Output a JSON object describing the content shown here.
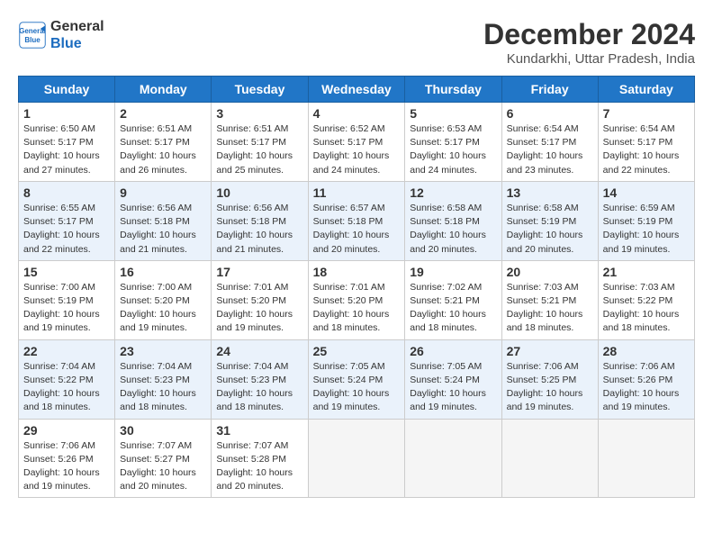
{
  "logo": {
    "line1": "General",
    "line2": "Blue"
  },
  "title": "December 2024",
  "location": "Kundarkhi, Uttar Pradesh, India",
  "weekdays": [
    "Sunday",
    "Monday",
    "Tuesday",
    "Wednesday",
    "Thursday",
    "Friday",
    "Saturday"
  ],
  "weeks": [
    [
      {
        "day": 1,
        "sunrise": "6:50 AM",
        "sunset": "5:17 PM",
        "daylight": "10 hours and 27 minutes."
      },
      {
        "day": 2,
        "sunrise": "6:51 AM",
        "sunset": "5:17 PM",
        "daylight": "10 hours and 26 minutes."
      },
      {
        "day": 3,
        "sunrise": "6:51 AM",
        "sunset": "5:17 PM",
        "daylight": "10 hours and 25 minutes."
      },
      {
        "day": 4,
        "sunrise": "6:52 AM",
        "sunset": "5:17 PM",
        "daylight": "10 hours and 24 minutes."
      },
      {
        "day": 5,
        "sunrise": "6:53 AM",
        "sunset": "5:17 PM",
        "daylight": "10 hours and 24 minutes."
      },
      {
        "day": 6,
        "sunrise": "6:54 AM",
        "sunset": "5:17 PM",
        "daylight": "10 hours and 23 minutes."
      },
      {
        "day": 7,
        "sunrise": "6:54 AM",
        "sunset": "5:17 PM",
        "daylight": "10 hours and 22 minutes."
      }
    ],
    [
      {
        "day": 8,
        "sunrise": "6:55 AM",
        "sunset": "5:17 PM",
        "daylight": "10 hours and 22 minutes."
      },
      {
        "day": 9,
        "sunrise": "6:56 AM",
        "sunset": "5:18 PM",
        "daylight": "10 hours and 21 minutes."
      },
      {
        "day": 10,
        "sunrise": "6:56 AM",
        "sunset": "5:18 PM",
        "daylight": "10 hours and 21 minutes."
      },
      {
        "day": 11,
        "sunrise": "6:57 AM",
        "sunset": "5:18 PM",
        "daylight": "10 hours and 20 minutes."
      },
      {
        "day": 12,
        "sunrise": "6:58 AM",
        "sunset": "5:18 PM",
        "daylight": "10 hours and 20 minutes."
      },
      {
        "day": 13,
        "sunrise": "6:58 AM",
        "sunset": "5:19 PM",
        "daylight": "10 hours and 20 minutes."
      },
      {
        "day": 14,
        "sunrise": "6:59 AM",
        "sunset": "5:19 PM",
        "daylight": "10 hours and 19 minutes."
      }
    ],
    [
      {
        "day": 15,
        "sunrise": "7:00 AM",
        "sunset": "5:19 PM",
        "daylight": "10 hours and 19 minutes."
      },
      {
        "day": 16,
        "sunrise": "7:00 AM",
        "sunset": "5:20 PM",
        "daylight": "10 hours and 19 minutes."
      },
      {
        "day": 17,
        "sunrise": "7:01 AM",
        "sunset": "5:20 PM",
        "daylight": "10 hours and 19 minutes."
      },
      {
        "day": 18,
        "sunrise": "7:01 AM",
        "sunset": "5:20 PM",
        "daylight": "10 hours and 18 minutes."
      },
      {
        "day": 19,
        "sunrise": "7:02 AM",
        "sunset": "5:21 PM",
        "daylight": "10 hours and 18 minutes."
      },
      {
        "day": 20,
        "sunrise": "7:03 AM",
        "sunset": "5:21 PM",
        "daylight": "10 hours and 18 minutes."
      },
      {
        "day": 21,
        "sunrise": "7:03 AM",
        "sunset": "5:22 PM",
        "daylight": "10 hours and 18 minutes."
      }
    ],
    [
      {
        "day": 22,
        "sunrise": "7:04 AM",
        "sunset": "5:22 PM",
        "daylight": "10 hours and 18 minutes."
      },
      {
        "day": 23,
        "sunrise": "7:04 AM",
        "sunset": "5:23 PM",
        "daylight": "10 hours and 18 minutes."
      },
      {
        "day": 24,
        "sunrise": "7:04 AM",
        "sunset": "5:23 PM",
        "daylight": "10 hours and 18 minutes."
      },
      {
        "day": 25,
        "sunrise": "7:05 AM",
        "sunset": "5:24 PM",
        "daylight": "10 hours and 19 minutes."
      },
      {
        "day": 26,
        "sunrise": "7:05 AM",
        "sunset": "5:24 PM",
        "daylight": "10 hours and 19 minutes."
      },
      {
        "day": 27,
        "sunrise": "7:06 AM",
        "sunset": "5:25 PM",
        "daylight": "10 hours and 19 minutes."
      },
      {
        "day": 28,
        "sunrise": "7:06 AM",
        "sunset": "5:26 PM",
        "daylight": "10 hours and 19 minutes."
      }
    ],
    [
      {
        "day": 29,
        "sunrise": "7:06 AM",
        "sunset": "5:26 PM",
        "daylight": "10 hours and 19 minutes."
      },
      {
        "day": 30,
        "sunrise": "7:07 AM",
        "sunset": "5:27 PM",
        "daylight": "10 hours and 20 minutes."
      },
      {
        "day": 31,
        "sunrise": "7:07 AM",
        "sunset": "5:28 PM",
        "daylight": "10 hours and 20 minutes."
      },
      null,
      null,
      null,
      null
    ]
  ]
}
